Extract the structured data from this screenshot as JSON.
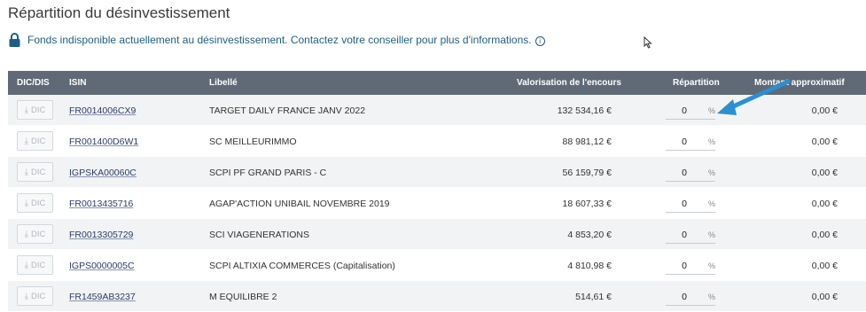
{
  "page": {
    "title": "Répartition du désinvestissement",
    "notice": "Fonds indisponible actuellement au désinvestissement. Contactez votre conseiller pour plus d'informations."
  },
  "colors": {
    "header_bg": "#5f6a76",
    "notice_text": "#1d5e87",
    "arrow": "#2b8fd1"
  },
  "table": {
    "headers": {
      "dic": "DIC/DIS",
      "isin": "ISIN",
      "libelle": "Libellé",
      "valorisation": "Valorisation de l'encours",
      "repartition": "Répartition",
      "montant": "Montant approximatif"
    },
    "dic_label": "DIC",
    "pct_symbol": "%",
    "rows": [
      {
        "isin": "FR0014006CX9",
        "libelle": "TARGET DAILY FRANCE JANV 2022",
        "valorisation": "132 534,16 €",
        "repartition": "0",
        "montant": "0,00 €"
      },
      {
        "isin": "FR001400D6W1",
        "libelle": "SC MEILLEURIMMO",
        "valorisation": "88 981,12 €",
        "repartition": "0",
        "montant": "0,00 €"
      },
      {
        "isin": "IGPSKA00060C",
        "libelle": "SCPI PF GRAND PARIS - C",
        "valorisation": "56 159,79 €",
        "repartition": "0",
        "montant": "0,00 €"
      },
      {
        "isin": "FR0013435716",
        "libelle": "AGAP'ACTION UNIBAIL NOVEMBRE 2019",
        "valorisation": "18 607,33 €",
        "repartition": "0",
        "montant": "0,00 €"
      },
      {
        "isin": "FR0013305729",
        "libelle": "SCI VIAGENERATIONS",
        "valorisation": "4 853,20 €",
        "repartition": "0",
        "montant": "0,00 €"
      },
      {
        "isin": "IGPS0000005C",
        "libelle": "SCPI ALTIXIA COMMERCES (Capitalisation)",
        "valorisation": "4 810,98 €",
        "repartition": "0",
        "montant": "0,00 €"
      },
      {
        "isin": "FR1459AB3237",
        "libelle": "M EQUILIBRE 2",
        "valorisation": "514,61 €",
        "repartition": "0",
        "montant": "0,00 €"
      }
    ]
  }
}
